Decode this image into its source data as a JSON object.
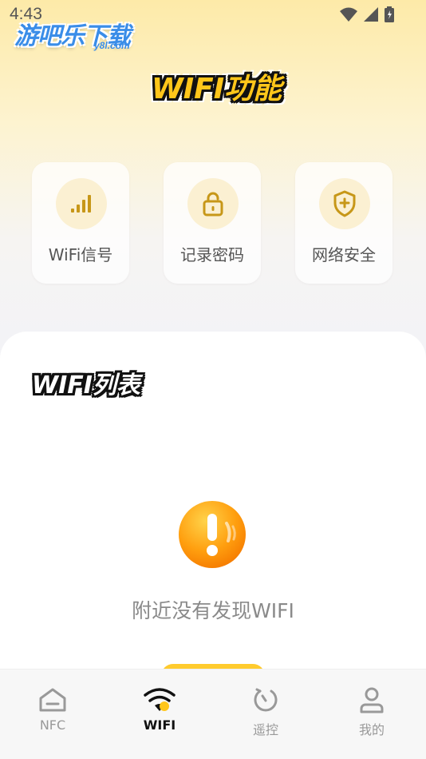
{
  "status_bar": {
    "time": "4:43",
    "icons": [
      "wifi-icon",
      "cellular-icon",
      "battery-icon"
    ]
  },
  "watermark": {
    "text": "游吧乐下载",
    "sub": "y8l.com"
  },
  "features_section": {
    "title": "WIFI功能",
    "items": [
      {
        "label": "WiFi信号",
        "icon": "signal-bars-icon"
      },
      {
        "label": "记录密码",
        "icon": "unlock-icon"
      },
      {
        "label": "网络安全",
        "icon": "shield-plus-icon"
      }
    ]
  },
  "wifi_list": {
    "title": "WIFI列表",
    "empty_icon": "exclamation-icon",
    "empty_text": "附近没有发现WIFI"
  },
  "bottom_nav": {
    "active": "WIFI",
    "items": [
      {
        "label": "NFC",
        "icon": "home-icon"
      },
      {
        "label": "WIFI",
        "icon": "wifi-icon"
      },
      {
        "label": "遥控",
        "icon": "remote-icon"
      },
      {
        "label": "我的",
        "icon": "user-icon"
      }
    ]
  },
  "colors": {
    "accent": "#ffc61a",
    "icon_bg": "#fbf0d2",
    "icon_fg": "#c79718",
    "text_muted": "#8a8a8a"
  }
}
